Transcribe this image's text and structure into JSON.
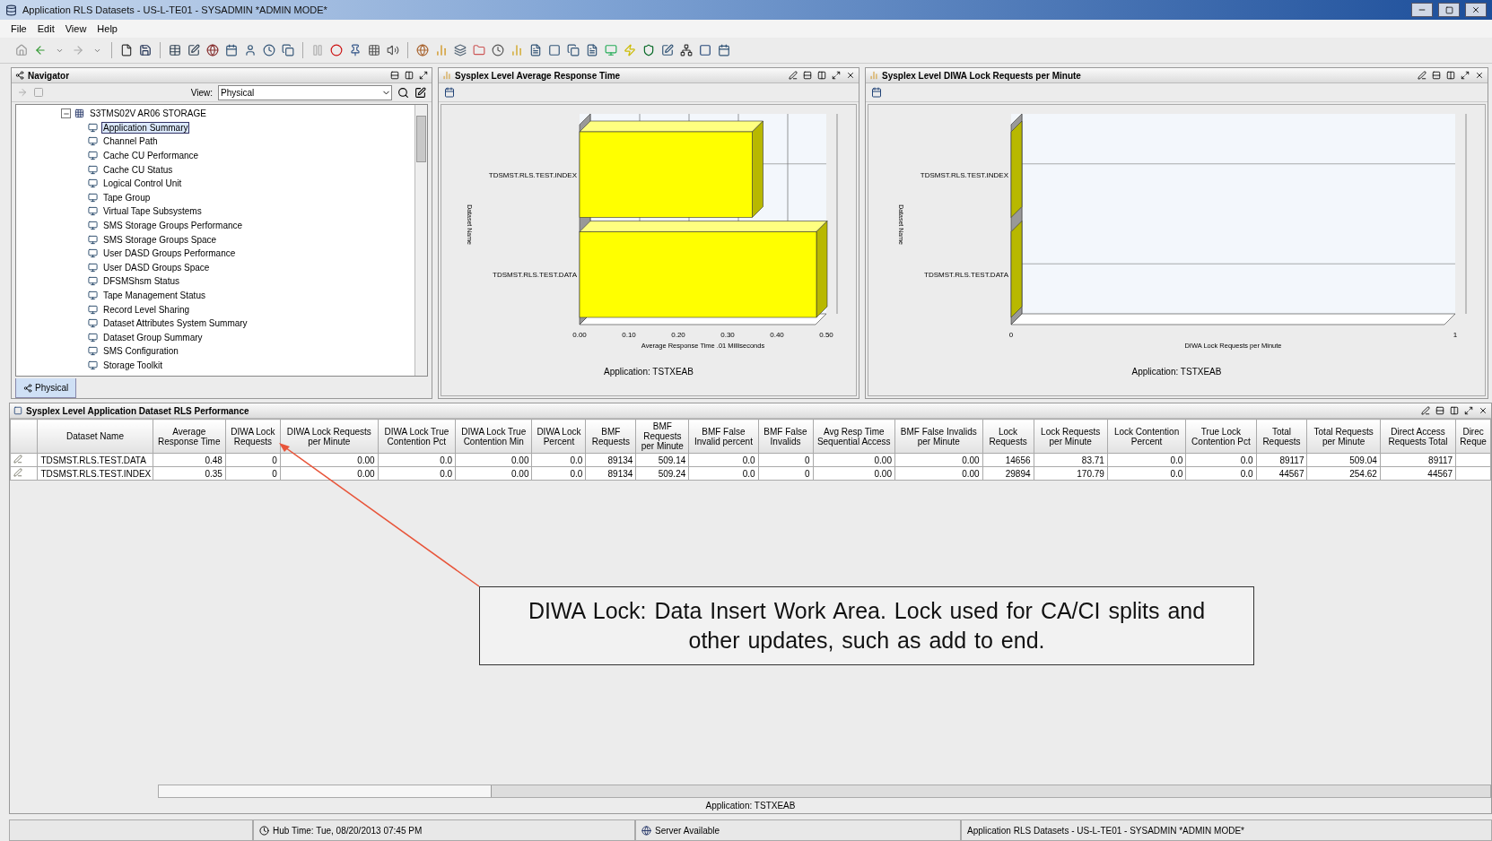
{
  "window": {
    "title": "Application RLS Datasets - US-L-TE01 - SYSADMIN   *ADMIN MODE*"
  },
  "menu": [
    "File",
    "Edit",
    "View",
    "Help"
  ],
  "navigator": {
    "title": "Navigator",
    "view_label": "View:",
    "view_value": "Physical",
    "tree": [
      {
        "label": "S3TMS02V AR06 STORAGE",
        "expanded": true,
        "children": [
          {
            "label": "Application Summary",
            "selected": true
          },
          {
            "label": "Channel Path",
            "selected": false
          },
          {
            "label": "Cache CU Performance",
            "selected": false
          },
          {
            "label": "Cache CU Status",
            "selected": false
          },
          {
            "label": "Logical Control Unit",
            "selected": false
          },
          {
            "label": "Tape Group",
            "selected": false
          },
          {
            "label": "Virtual Tape Subsystems",
            "selected": false
          },
          {
            "label": "SMS Storage Groups Performance",
            "selected": false
          },
          {
            "label": "SMS Storage Groups Space",
            "selected": false
          },
          {
            "label": "User DASD Groups Performance",
            "selected": false
          },
          {
            "label": "User DASD Groups Space",
            "selected": false
          },
          {
            "label": "DFSMShsm Status",
            "selected": false
          },
          {
            "label": "Tape Management Status",
            "selected": false
          },
          {
            "label": "Record Level Sharing",
            "selected": false
          },
          {
            "label": "Dataset Attributes System Summary",
            "selected": false
          },
          {
            "label": "Dataset Group Summary",
            "selected": false
          },
          {
            "label": "SMS Configuration",
            "selected": false
          },
          {
            "label": "Storage Toolkit",
            "selected": false
          }
        ]
      }
    ],
    "tabs": [
      {
        "label": "Physical",
        "selected": true
      }
    ]
  },
  "charts": [
    {
      "title": "Sysplex Level Average Response Time",
      "caption": "Application:  TSTXEAB",
      "chart_data": {
        "type": "bar",
        "orientation": "horizontal",
        "xlabel": "Average Response Time .01 Milliseconds",
        "ylabel": "Dataset Name",
        "categories": [
          "TDSMST.RLS.TEST.INDEX",
          "TDSMST.RLS.TEST.DATA"
        ],
        "values": [
          0.35,
          0.48
        ],
        "xlim": [
          0,
          0.5
        ],
        "xticks": [
          {
            "value": 0,
            "label": "0.00"
          },
          {
            "value": 0.1,
            "label": "0.10"
          },
          {
            "value": 0.2,
            "label": "0.20"
          },
          {
            "value": 0.3,
            "label": "0.30"
          },
          {
            "value": 0.4,
            "label": "0.40"
          },
          {
            "value": 0.5,
            "label": "0.50"
          }
        ]
      }
    },
    {
      "title": "Sysplex Level DIWA Lock Requests per Minute",
      "caption": "Application:  TSTXEAB",
      "chart_data": {
        "type": "bar",
        "orientation": "horizontal",
        "xlabel": "DIWA Lock Requests per Minute",
        "ylabel": "Dataset Name",
        "categories": [
          "TDSMST.RLS.TEST.INDEX",
          "TDSMST.RLS.TEST.DATA"
        ],
        "values": [
          0,
          0
        ],
        "xlim": [
          0,
          1
        ],
        "xticks": [
          0,
          1
        ]
      }
    }
  ],
  "table": {
    "title": "Sysplex Level Application Dataset RLS Performance",
    "columns": [
      "Dataset Name",
      "Average Response Time",
      "DIWA Lock Requests",
      "DIWA Lock Requests per Minute",
      "DIWA Lock True Contention Pct",
      "DIWA Lock True Contention Min",
      "DIWA Lock Percent",
      "BMF Requests",
      "BMF Requests per Minute",
      "BMF False Invalid percent",
      "BMF False Invalids",
      "Avg Resp Time Sequential Access",
      "BMF False Invalids per Minute",
      "Lock Requests",
      "Lock Requests per Minute",
      "Lock Contention Percent",
      "True Lock Contention Pct",
      "Total Requests",
      "Total Requests per Minute",
      "Direct Access Requests Total",
      "Direc Reque"
    ],
    "rows": [
      [
        "TDSMST.RLS.TEST.DATA",
        "0.48",
        "0",
        "0.00",
        "0.0",
        "0.00",
        "0.0",
        "89134",
        "509.14",
        "0.0",
        "0",
        "0.00",
        "0.00",
        "14656",
        "83.71",
        "0.0",
        "0.0",
        "89117",
        "509.04",
        "89117"
      ],
      [
        "TDSMST.RLS.TEST.INDEX",
        "0.35",
        "0",
        "0.00",
        "0.0",
        "0.00",
        "0.0",
        "89134",
        "509.24",
        "0.0",
        "0",
        "0.00",
        "0.00",
        "29894",
        "170.79",
        "0.0",
        "0.0",
        "44567",
        "254.62",
        "44567"
      ]
    ],
    "caption": "Application:  TSTXEAB"
  },
  "callout": "DIWA Lock:  Data Insert Work Area.  Lock used for CA/CI splits and other updates, such as add to end.",
  "status_bar": [
    "Hub Time: Tue, 08/20/2013 07:45 PM",
    "Server Available",
    "Application RLS Datasets - US-L-TE01 - SYSADMIN   *ADMIN MODE*"
  ]
}
